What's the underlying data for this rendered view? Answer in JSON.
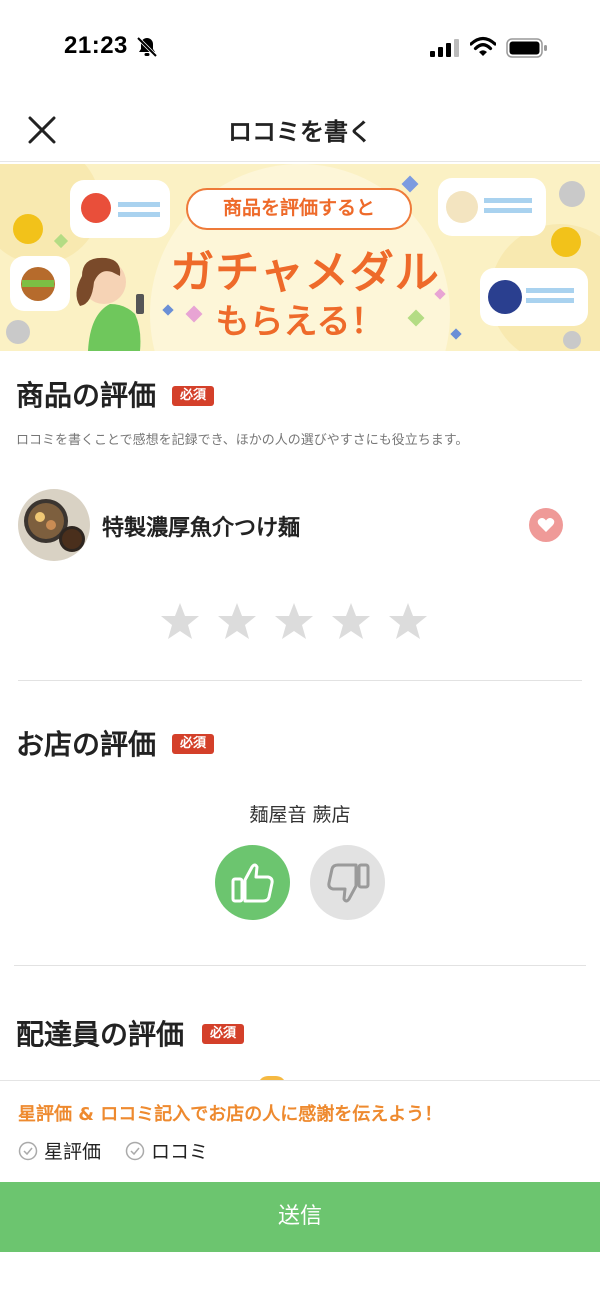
{
  "status_bar": {
    "time": "21:23"
  },
  "header": {
    "title": "ロコミを書く"
  },
  "banner": {
    "pill": "商品を評価すると",
    "headline": "ガチャメダル",
    "sub": "もらえる！"
  },
  "product_section": {
    "title": "商品の評価",
    "required": "必須",
    "description": "ロコミを書くことで感想を記録でき、ほかの人の選びやすさにも役立ちます。",
    "product_name": "特製濃厚魚介つけ麺",
    "rating": 0,
    "max_rating": 5
  },
  "shop_section": {
    "title": "お店の評価",
    "required": "必須",
    "shop_name": "麺屋音 蕨店",
    "selected": "thumbs-up"
  },
  "courier_section": {
    "title": "配達員の評価",
    "required": "必須"
  },
  "bottom": {
    "thanks": "星評価 & ロコミ記入でお店の人に感謝を伝えよう！",
    "checks": [
      "星評価",
      "ロコミ"
    ],
    "submit": "送信"
  },
  "colors": {
    "accent_green": "#6cc56f",
    "required_red": "#d4402a",
    "orange": "#ee6a2a"
  }
}
